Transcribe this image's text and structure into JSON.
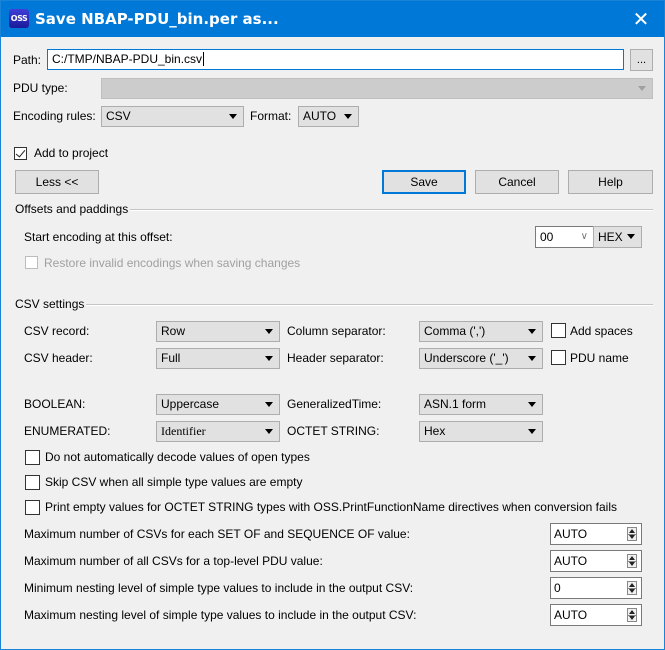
{
  "window": {
    "title": "Save NBAP-PDU_bin.per as...",
    "app_icon_text": "OSS",
    "close_glyph": "✕"
  },
  "path": {
    "label": "Path:",
    "value": "C:/TMP/NBAP-PDU_bin.csv",
    "browse_label": "..."
  },
  "pdu_type": {
    "label": "PDU type:",
    "value": ""
  },
  "encoding": {
    "label": "Encoding rules:",
    "value": "CSV",
    "format_label": "Format:",
    "format_value": "AUTO"
  },
  "add_to_project": {
    "label": "Add to project",
    "checked": true
  },
  "buttons": {
    "less": "Less <<",
    "save": "Save",
    "cancel": "Cancel",
    "help": "Help"
  },
  "offsets": {
    "group_title": "Offsets and paddings",
    "start_label": "Start encoding at this offset:",
    "start_value": "00",
    "start_base": "HEX",
    "restore_label": "Restore invalid encodings when saving changes",
    "restore_checked": false
  },
  "csv": {
    "group_title": "CSV settings",
    "record_label": "CSV record:",
    "record_value": "Row",
    "column_sep_label": "Column separator:",
    "column_sep_value": "Comma (',')",
    "add_spaces_label": "Add spaces",
    "add_spaces_checked": false,
    "header_label": "CSV header:",
    "header_value": "Full",
    "header_sep_label": "Header separator:",
    "header_sep_value": "Underscore ('_')",
    "pdu_name_label": "PDU name",
    "pdu_name_checked": false,
    "boolean_label": "BOOLEAN:",
    "boolean_value": "Uppercase",
    "gentime_label": "GeneralizedTime:",
    "gentime_value": "ASN.1 form",
    "enumerated_label": "ENUMERATED:",
    "enumerated_value": "Identifier",
    "octet_label": "OCTET STRING:",
    "octet_value": "Hex",
    "checkboxes": [
      {
        "label": "Do not automatically decode values of open types",
        "checked": false
      },
      {
        "label": "Skip CSV when all simple type values are empty",
        "checked": false
      },
      {
        "label": "Print empty values for OCTET STRING types with OSS.PrintFunctionName directives when conversion fails",
        "checked": false
      }
    ],
    "spinners": [
      {
        "label": "Maximum number of CSVs for each SET OF and SEQUENCE OF value:",
        "value": "AUTO"
      },
      {
        "label": "Maximum number of all CSVs for a top-level PDU value:",
        "value": "AUTO"
      },
      {
        "label": "Minimum nesting level of simple type values to include in the output CSV:",
        "value": "0"
      },
      {
        "label": "Maximum nesting level of simple type values to include in the output CSV:",
        "value": "AUTO"
      }
    ]
  }
}
